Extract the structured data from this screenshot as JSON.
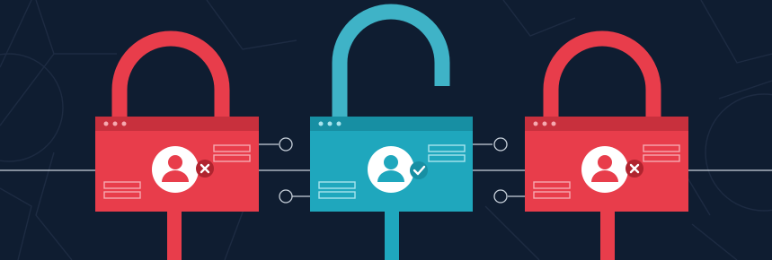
{
  "colors": {
    "background": "#0f1d31",
    "pattern": "#1d2b42",
    "wire": "#c9d2dc",
    "locked": "#e83d4b",
    "locked_shade": "#c8303d",
    "locked_dark": "#b0242f",
    "locked_line": "#f6a9b0",
    "unlocked": "#1fa7bd",
    "unlocked_shackle": "#3fb3c7",
    "unlocked_shade": "#178fa3",
    "unlocked_line": "#a8e4ee",
    "avatar_bg": "#ffffff",
    "badge_check": "#178fa3"
  },
  "locks": [
    {
      "state": "locked",
      "shackle_state": "closed",
      "status_icon": "x-icon"
    },
    {
      "state": "unlocked",
      "shackle_state": "open",
      "status_icon": "check-icon"
    },
    {
      "state": "locked",
      "shackle_state": "closed",
      "status_icon": "x-icon"
    }
  ]
}
